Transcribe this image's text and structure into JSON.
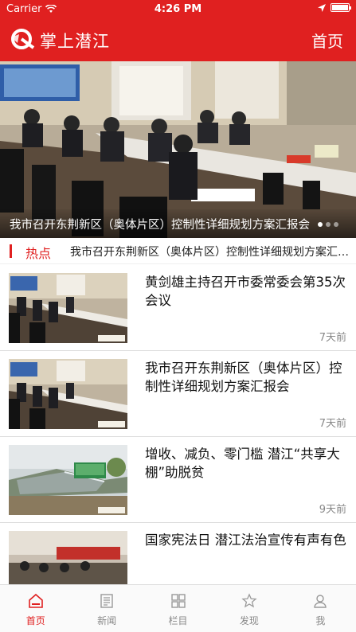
{
  "status_bar": {
    "carrier": "Carrier",
    "time": "4:26 PM"
  },
  "header": {
    "title": "掌上潜江",
    "home_link": "首页"
  },
  "banner": {
    "caption": "我市召开东荆新区（奥体片区）控制性详细规划方案汇报会"
  },
  "hot": {
    "label": "热点",
    "text": "我市召开东荆新区（奥体片区）控制性详细规划方案汇报会"
  },
  "news": [
    {
      "title": "黄剑雄主持召开市委常委会第35次会议",
      "time": "7天前"
    },
    {
      "title": "我市召开东荆新区（奥体片区）控制性详细规划方案汇报会",
      "time": "7天前"
    },
    {
      "title": "增收、减负、零门槛 潜江“共享大棚”助脱贫",
      "time": "9天前"
    },
    {
      "title": "国家宪法日 潜江法治宣传有声有色",
      "time": ""
    }
  ],
  "tabs": [
    {
      "label": "首页",
      "icon": "home-icon"
    },
    {
      "label": "新闻",
      "icon": "news-icon"
    },
    {
      "label": "栏目",
      "icon": "grid-icon"
    },
    {
      "label": "发现",
      "icon": "discover-icon"
    },
    {
      "label": "我",
      "icon": "user-icon"
    }
  ],
  "colors": {
    "brand": "#e02020",
    "tab_inactive": "#888888"
  }
}
